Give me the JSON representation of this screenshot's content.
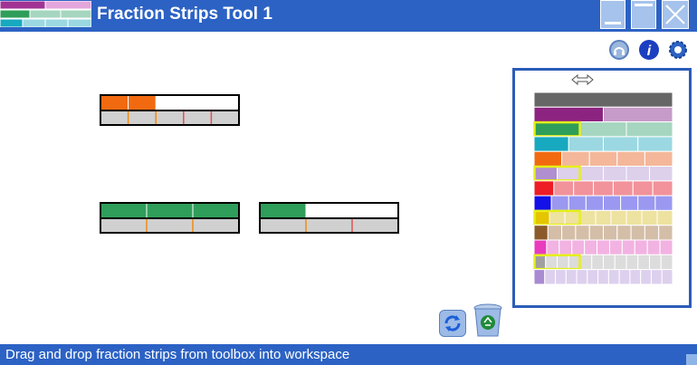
{
  "window": {
    "title": "Fraction Strips Tool 1",
    "buttons": [
      "minimize",
      "maximize",
      "close"
    ]
  },
  "toolbar": {
    "icons": [
      "speaker-icon",
      "info-icon",
      "settings-gear-icon"
    ],
    "info_glyph": "i"
  },
  "workspace": {
    "strips": [
      {
        "denominator": 5,
        "shaded": 2,
        "color": "#f26a10"
      },
      {
        "denominator": 3,
        "shaded": 3,
        "color": "#2f9e5a"
      },
      {
        "denominator": 3,
        "shaded": 1,
        "color": "#2f9e5a"
      }
    ]
  },
  "toolbox": {
    "resize_icon": "horizontal-resize-arrow-icon",
    "rows": [
      {
        "denominator": 1,
        "dark": "#666666",
        "light": "#666666"
      },
      {
        "denominator": 2,
        "dark": "#8c2380",
        "light": "#c79bc9",
        "selected": false
      },
      {
        "denominator": 3,
        "dark": "#2f9e5a",
        "light": "#a6d6c0",
        "selected": true
      },
      {
        "denominator": 4,
        "dark": "#17a9c0",
        "light": "#9bd8e2"
      },
      {
        "denominator": 5,
        "dark": "#f26a10",
        "light": "#f4b79a"
      },
      {
        "denominator": 6,
        "dark": "#b08fd0",
        "light": "#ddd0eb",
        "selected": true
      },
      {
        "denominator": 7,
        "dark": "#ee1c24",
        "light": "#f2929a"
      },
      {
        "denominator": 8,
        "dark": "#1410e8",
        "light": "#9a98f0"
      },
      {
        "denominator": 9,
        "dark": "#e5c400",
        "light": "#eee2a0",
        "selected": true
      },
      {
        "denominator": 10,
        "dark": "#8b5a2b",
        "light": "#d4bea8"
      },
      {
        "denominator": 11,
        "dark": "#e83cbd",
        "light": "#f2b2e2"
      },
      {
        "denominator": 12,
        "dark": "#a0a0a0",
        "light": "#dcdcdc",
        "selected": true
      },
      {
        "denominator": 13,
        "dark": "#a88bd0",
        "light": "#ddd0ee"
      }
    ]
  },
  "actions": {
    "icons": [
      "refresh-icon",
      "recycle-bin-icon"
    ]
  },
  "status": {
    "text": "Drag and drop fraction strips from toolbox into workspace"
  },
  "colors": {
    "titlebar": "#2c62c4",
    "toolbox_border": "#2b5cb8",
    "selected_outline": "#e6ef1a",
    "window_button": "#a5c3ec"
  }
}
